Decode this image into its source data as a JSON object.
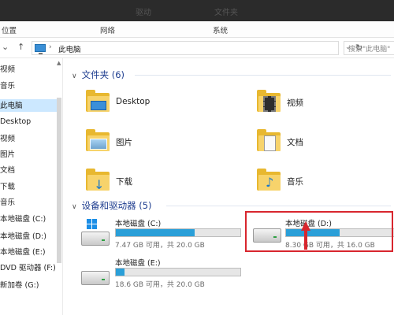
{
  "titlebar": {
    "left_text": "驱动",
    "right_text": "文件夹"
  },
  "ribbon": {
    "tabs": [
      "位置",
      "网络",
      "系统"
    ]
  },
  "address": {
    "crumb": "此电脑",
    "search_placeholder": "搜索\"此电脑\""
  },
  "sidebar": {
    "items": [
      {
        "label": "视频",
        "selected": false
      },
      {
        "label": "音乐",
        "selected": false
      },
      {
        "label": "此电脑",
        "selected": true
      },
      {
        "label": "Desktop",
        "selected": false
      },
      {
        "label": "视频",
        "selected": false
      },
      {
        "label": "图片",
        "selected": false
      },
      {
        "label": "文档",
        "selected": false
      },
      {
        "label": "下载",
        "selected": false
      },
      {
        "label": "音乐",
        "selected": false
      },
      {
        "label": "本地磁盘 (C:)",
        "selected": false
      },
      {
        "label": "本地磁盘 (D:)",
        "selected": false
      },
      {
        "label": "本地磁盘 (E:)",
        "selected": false
      },
      {
        "label": "DVD 驱动器 (F:)",
        "selected": false
      },
      {
        "label": "新加卷 (G:)",
        "selected": false
      }
    ]
  },
  "folders": {
    "header": "文件夹 (6)",
    "items": [
      {
        "label": "Desktop",
        "icon": "desktop-folder-icon"
      },
      {
        "label": "视频",
        "icon": "videos-folder-icon"
      },
      {
        "label": "图片",
        "icon": "pictures-folder-icon"
      },
      {
        "label": "文档",
        "icon": "documents-folder-icon"
      },
      {
        "label": "下载",
        "icon": "downloads-folder-icon"
      },
      {
        "label": "音乐",
        "icon": "music-folder-icon"
      }
    ]
  },
  "drives": {
    "header": "设备和驱动器 (5)",
    "items": [
      {
        "name": "本地磁盘 (C:)",
        "free": "7.47 GB 可用，共 20.0 GB",
        "used_fraction": 0.63
      },
      {
        "name": "本地磁盘 (D:)",
        "free": "8.30 GB 可用，共 16.0 GB",
        "used_fraction": 0.49
      },
      {
        "name": "本地磁盘 (E:)",
        "free": "18.6 GB 可用，共 20.0 GB",
        "used_fraction": 0.07
      }
    ]
  },
  "colors": {
    "accent": "#2a9fd8",
    "highlight": "#d8262e",
    "section": "#1e3d8f"
  }
}
